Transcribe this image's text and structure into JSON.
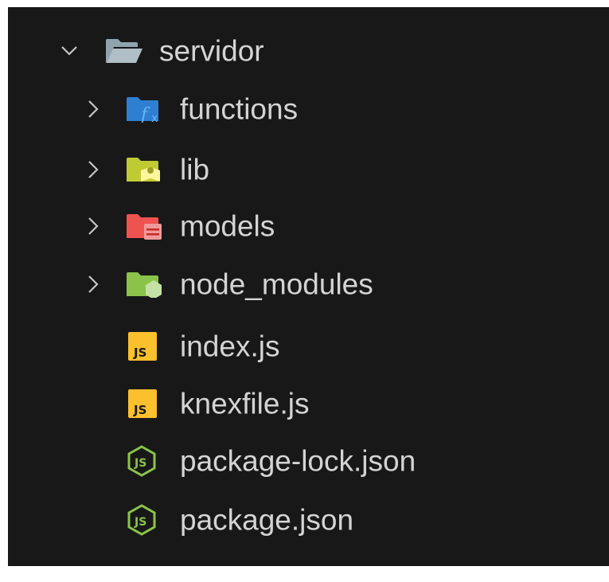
{
  "explorer": {
    "root": {
      "name": "servidor",
      "expanded": true,
      "icon": "folder-open-icon"
    },
    "items": [
      {
        "name": "functions",
        "type": "folder",
        "expanded": false,
        "icon": "folder-functions-icon",
        "color": "#2f7fd1"
      },
      {
        "name": "lib",
        "type": "folder",
        "expanded": false,
        "icon": "folder-lib-icon",
        "color": "#c0ca33"
      },
      {
        "name": "models",
        "type": "folder",
        "expanded": false,
        "icon": "folder-models-icon",
        "color": "#ef5350"
      },
      {
        "name": "node_modules",
        "type": "folder",
        "expanded": false,
        "icon": "folder-node-icon",
        "color": "#8bc34a"
      },
      {
        "name": "index.js",
        "type": "file",
        "icon": "javascript-file-icon",
        "color": "#fbc02d"
      },
      {
        "name": "knexfile.js",
        "type": "file",
        "icon": "javascript-file-icon",
        "color": "#fbc02d"
      },
      {
        "name": "package-lock.json",
        "type": "file",
        "icon": "nodejs-file-icon",
        "color": "#8bc34a"
      },
      {
        "name": "package.json",
        "type": "file",
        "icon": "nodejs-file-icon",
        "color": "#8bc34a"
      }
    ]
  },
  "colors": {
    "background": "#181818",
    "text": "#d4d4d4",
    "chevron": "#c5c5c5"
  }
}
